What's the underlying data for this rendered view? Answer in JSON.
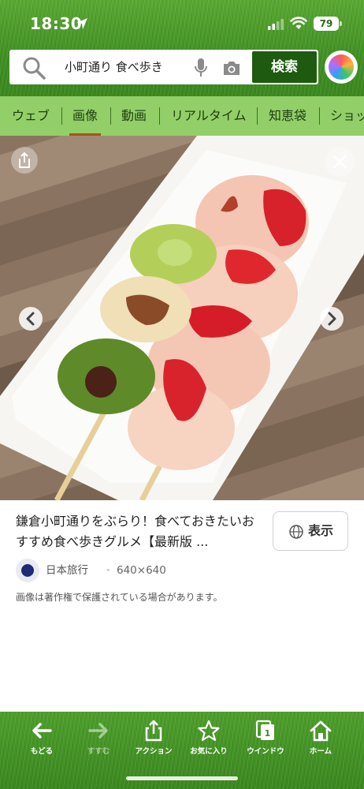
{
  "status_bar": {
    "time": "18:30",
    "battery": "79"
  },
  "search": {
    "query": "小町通り 食べ歩き",
    "button_label": "検索"
  },
  "tabs": [
    {
      "label": "ウェブ"
    },
    {
      "label": "画像"
    },
    {
      "label": "動画"
    },
    {
      "label": "リアルタイム"
    },
    {
      "label": "知恵袋"
    },
    {
      "label": "ショッ"
    }
  ],
  "result": {
    "title": "鎌倉小町通りをぶらり！食べておきたいおすすめ食べ歩きグルメ【最新版 ...",
    "view_label": "表示",
    "source_name": "日本旅行",
    "separator": "-",
    "dimensions": "640×640",
    "copyright_notice": "画像は著作権で保護されている場合があります。"
  },
  "toolbar": [
    {
      "label": "もどる",
      "icon": "back-arrow-icon"
    },
    {
      "label": "すすむ",
      "icon": "forward-arrow-icon"
    },
    {
      "label": "アクション",
      "icon": "share-icon"
    },
    {
      "label": "お気に入り",
      "icon": "star-icon"
    },
    {
      "label": "ウインドウ",
      "icon": "windows-icon",
      "badge": "1"
    },
    {
      "label": "ホーム",
      "icon": "home-icon"
    }
  ],
  "colors": {
    "brand_green": "#1e5a10",
    "tab_bg": "#92cf68",
    "active_tab_underline": "#a8531a"
  }
}
